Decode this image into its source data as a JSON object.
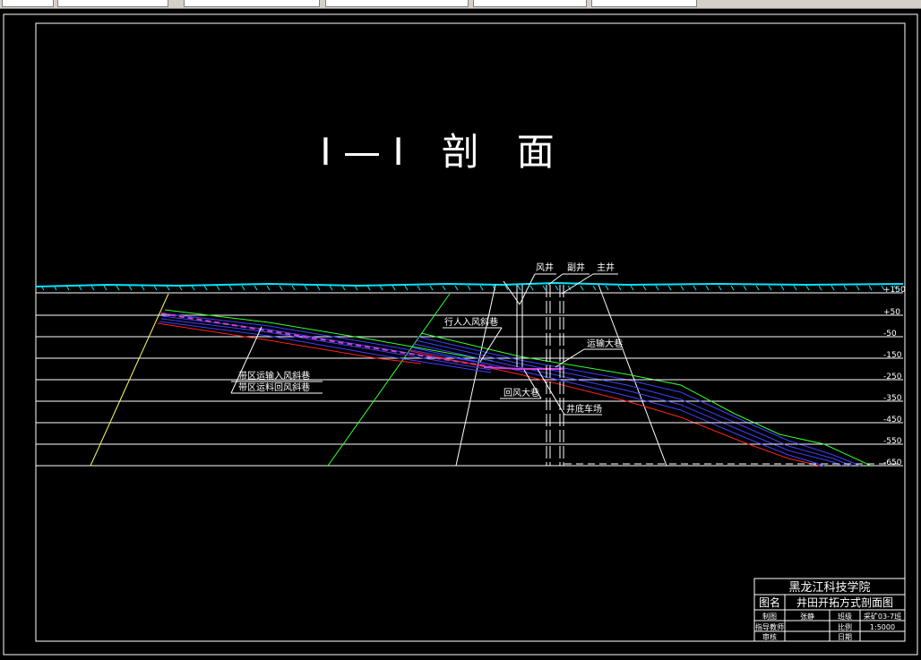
{
  "drawing": {
    "title": "I — I　剖　面",
    "levels": [
      "+150",
      "+50",
      "-50",
      "-150",
      "-250",
      "-350",
      "-450",
      "-550",
      "-650"
    ],
    "labels": {
      "air_shaft": "风井",
      "aux_shaft": "副井",
      "main_shaft": "主井",
      "pedestrian_incline": "行人入风斜巷",
      "haulage_roadway": "运输大巷",
      "return_roadway": "回风大巷",
      "shaft_bottom_yard": "井底车场",
      "panel_intake": "带区运输入风斜巷",
      "panel_return": "带区运料回风斜巷"
    }
  },
  "title_block": {
    "school": "黑龙江科技学院",
    "name_label": "图名",
    "name_value": "井田开拓方式剖面图",
    "drawn_label": "制图",
    "drawn_value": "张静",
    "class_label": "班级",
    "class_value": "采矿03-7班",
    "advisor_label": "指导教师",
    "scale_label": "比例",
    "scale_value": "1:5000",
    "review_label": "审核",
    "date_label": "日期"
  }
}
